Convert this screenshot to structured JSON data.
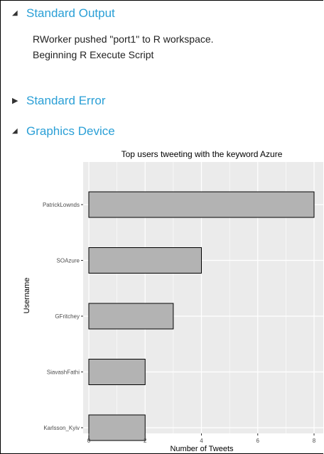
{
  "sections": {
    "standard_output": {
      "label": "Standard Output",
      "expanded": true
    },
    "standard_error": {
      "label": "Standard Error",
      "expanded": false
    },
    "graphics_device": {
      "label": "Graphics Device",
      "expanded": true
    }
  },
  "standard_output_lines": [
    "RWorker pushed \"port1\" to R workspace.",
    "Beginning R Execute Script"
  ],
  "chart_data": {
    "type": "bar",
    "orientation": "horizontal",
    "title": "Top users tweeting with the keyword Azure",
    "xlabel": "Number of Tweets",
    "ylabel": "Username",
    "categories": [
      "PatrickLownds",
      "SOAzure",
      "GFritchey",
      "SiavashFathi",
      "Karlsson_Kyiv"
    ],
    "values": [
      8,
      4,
      3,
      2,
      2
    ],
    "xlim": [
      0,
      8.3
    ],
    "x_ticks": [
      0,
      2,
      4,
      6,
      8
    ],
    "grid": true,
    "colors": {
      "panel": "#ebebeb",
      "bar_fill": "#b3b3b3",
      "bar_stroke": "#000000",
      "grid": "#ffffff"
    }
  }
}
